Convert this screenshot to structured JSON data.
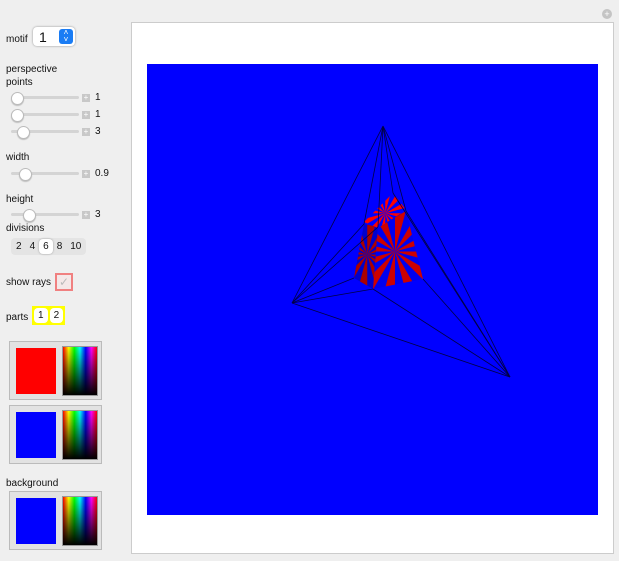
{
  "controls": {
    "motif_label": "motif",
    "motif_value": "1",
    "perspective_label": "perspective",
    "points_label": "points",
    "points": [
      {
        "value": "1",
        "fraction": 0.05
      },
      {
        "value": "1",
        "fraction": 0.05
      },
      {
        "value": "3",
        "fraction": 0.15
      }
    ],
    "width_label": "width",
    "width_value": "0.9",
    "width_fraction": 0.2,
    "height_label": "height",
    "height_value": "3",
    "height_fraction": 0.25,
    "divisions_label": "divisions",
    "divisions": [
      "2",
      "4",
      "6",
      "8",
      "10"
    ],
    "divisions_selected": "6",
    "show_rays_label": "show rays",
    "show_rays_checked": true,
    "parts_label": "parts",
    "parts": [
      "1",
      "2"
    ],
    "color1": "#ff0000",
    "color2": "#0000ff",
    "background_label": "background",
    "background_color": "#0000ff"
  },
  "plot": {
    "background": "#0000ff",
    "stripe_color": "#cc0000"
  }
}
